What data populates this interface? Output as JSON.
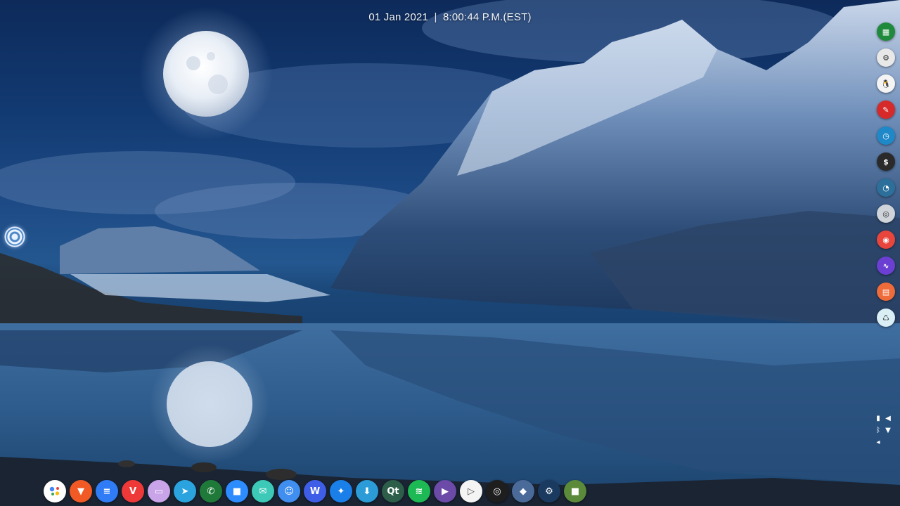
{
  "clock": {
    "date": "01 Jan 2021",
    "separator": "|",
    "time": "8:00:44 P.M.(EST)"
  },
  "left_launcher": {
    "icon": "app-launcher-icon"
  },
  "side_dock": {
    "items": [
      {
        "icon": "cpu-monitor-icon",
        "color": "#1f8a3b",
        "glyph": "▦"
      },
      {
        "icon": "settings-icon",
        "color": "#e8e8e8",
        "glyph": "⚙"
      },
      {
        "icon": "linux-penguin-icon",
        "color": "#f4f4f4",
        "glyph": "🐧"
      },
      {
        "icon": "text-editor-icon",
        "color": "#d62a2a",
        "glyph": "✎"
      },
      {
        "icon": "clock-app-icon",
        "color": "#1e88c8",
        "glyph": "◷"
      },
      {
        "icon": "terminal-icon",
        "color": "#2a2a2a",
        "glyph": "$"
      },
      {
        "icon": "system-speed-icon",
        "color": "#2b6f9a",
        "glyph": "◔"
      },
      {
        "icon": "messaging-icon",
        "color": "#cfd4da",
        "glyph": "◎"
      },
      {
        "icon": "chrome-browser-icon",
        "color": "#e8453c",
        "glyph": "◉"
      },
      {
        "icon": "audio-wave-icon",
        "color": "#6a3fd1",
        "glyph": "∿"
      },
      {
        "icon": "nfs-folder-icon",
        "color": "#ef6b3a",
        "glyph": "▤"
      },
      {
        "icon": "trash-icon",
        "color": "#d9eef5",
        "glyph": "♺"
      }
    ]
  },
  "tray": {
    "items": [
      {
        "icon": "clipboard-icon",
        "glyph": "▮"
      },
      {
        "icon": "volume-icon",
        "glyph": "◀"
      },
      {
        "icon": "bluetooth-icon",
        "glyph": "ᛒ"
      },
      {
        "icon": "wifi-icon",
        "glyph": "▼"
      },
      {
        "icon": "tray-expand-icon",
        "glyph": "◂"
      }
    ]
  },
  "bottom_dock": {
    "items": [
      {
        "icon": "google-assistant-icon",
        "color": "#ffffff",
        "glyph": "●"
      },
      {
        "icon": "brave-browser-icon",
        "color": "#f15a24",
        "glyph": "▼"
      },
      {
        "icon": "messages-icon",
        "color": "#2f7cf6",
        "glyph": "≡"
      },
      {
        "icon": "vivaldi-browser-icon",
        "color": "#ef3939",
        "glyph": "V"
      },
      {
        "icon": "disk-utility-icon",
        "color": "#c9a4e8",
        "glyph": "▭"
      },
      {
        "icon": "telegram-icon",
        "color": "#2aa3df",
        "glyph": "➤"
      },
      {
        "icon": "whatsapp-icon",
        "color": "#1f7a3a",
        "glyph": "✆"
      },
      {
        "icon": "zoom-icon",
        "color": "#2d8cff",
        "glyph": "■"
      },
      {
        "icon": "mail-icon",
        "color": "#3cc9b8",
        "glyph": "✉"
      },
      {
        "icon": "file-manager-icon",
        "color": "#3f8ef0",
        "glyph": "☺"
      },
      {
        "icon": "wps-office-icon",
        "color": "#3f5ee8",
        "glyph": "W"
      },
      {
        "icon": "telescope-icon",
        "color": "#1a7fe8",
        "glyph": "✦"
      },
      {
        "icon": "app-store-icon",
        "color": "#2b9cd8",
        "glyph": "⬇"
      },
      {
        "icon": "qt-creator-icon",
        "color": "#2c5e4a",
        "glyph": "Qt"
      },
      {
        "icon": "spotify-icon",
        "color": "#1db954",
        "glyph": "≋"
      },
      {
        "icon": "media-player-icon",
        "color": "#6b4aa8",
        "glyph": "▶"
      },
      {
        "icon": "play-button-icon",
        "color": "#f4f4f4",
        "glyph": "▷"
      },
      {
        "icon": "obs-studio-icon",
        "color": "#1e1e1e",
        "glyph": "◎"
      },
      {
        "icon": "audio-editor-icon",
        "color": "#4a6a9a",
        "glyph": "◆"
      },
      {
        "icon": "steam-icon",
        "color": "#1b3a60",
        "glyph": "⚙"
      },
      {
        "icon": "minecraft-icon",
        "color": "#5a8a3a",
        "glyph": "■"
      }
    ]
  }
}
